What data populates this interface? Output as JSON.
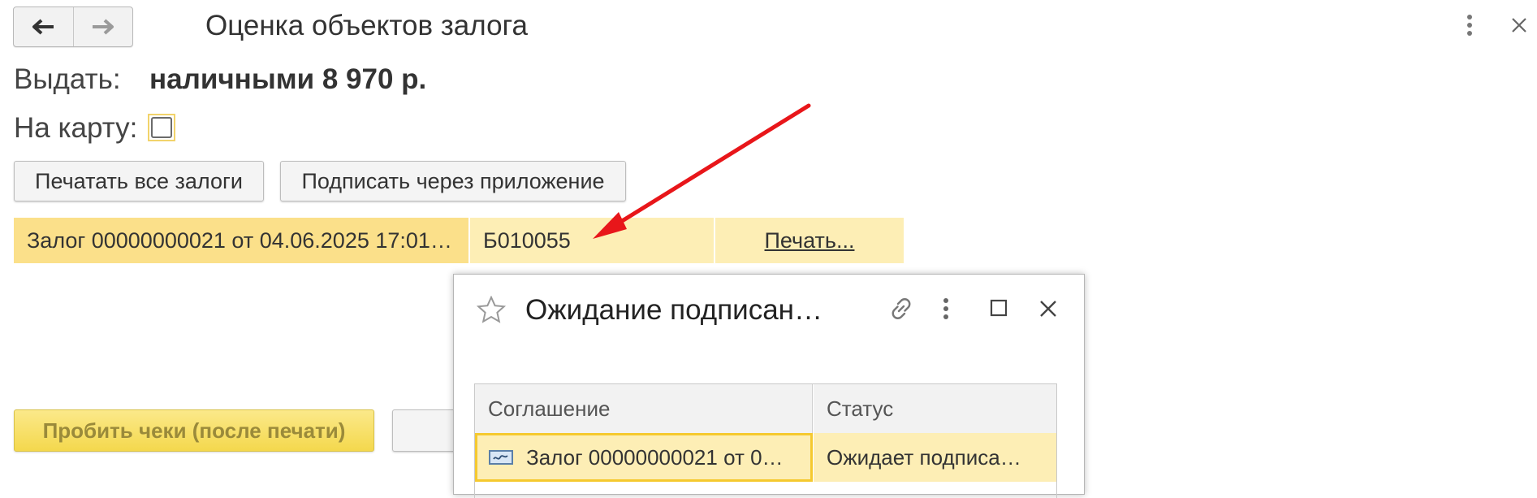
{
  "window": {
    "title": "Оценка объектов залога"
  },
  "payout": {
    "label": "Выдать:",
    "value": "наличными 8 970 р."
  },
  "card": {
    "label": "На карту:",
    "checked": false
  },
  "buttons": {
    "print_all": "Печатать все залоги",
    "sign_app": "Подписать через приложение",
    "checks": "Пробить чеки (после печати)"
  },
  "pledge_row": {
    "name": "Залог 00000000021 от 04.06.2025 17:01…",
    "code": "Б010055",
    "print_link": "Печать..."
  },
  "dialog": {
    "title": "Ожидание подписан…",
    "columns": [
      "Соглашение",
      "Статус"
    ],
    "rows": [
      {
        "agreement": "Залог 00000000021 от 0…",
        "status": "Ожидает подписа…"
      }
    ]
  },
  "icons": {
    "back": "arrow-left-icon",
    "forward": "arrow-right-icon",
    "more": "more-vertical-icon",
    "close": "close-icon",
    "star": "star-icon",
    "link": "link-icon",
    "maximize": "maximize-icon",
    "document": "document-icon"
  },
  "colors": {
    "row_highlight": "#fdeeb5",
    "row_selected": "#fbe08a",
    "button_yellow": "#f4d84d",
    "arrow": "#e8161a"
  }
}
